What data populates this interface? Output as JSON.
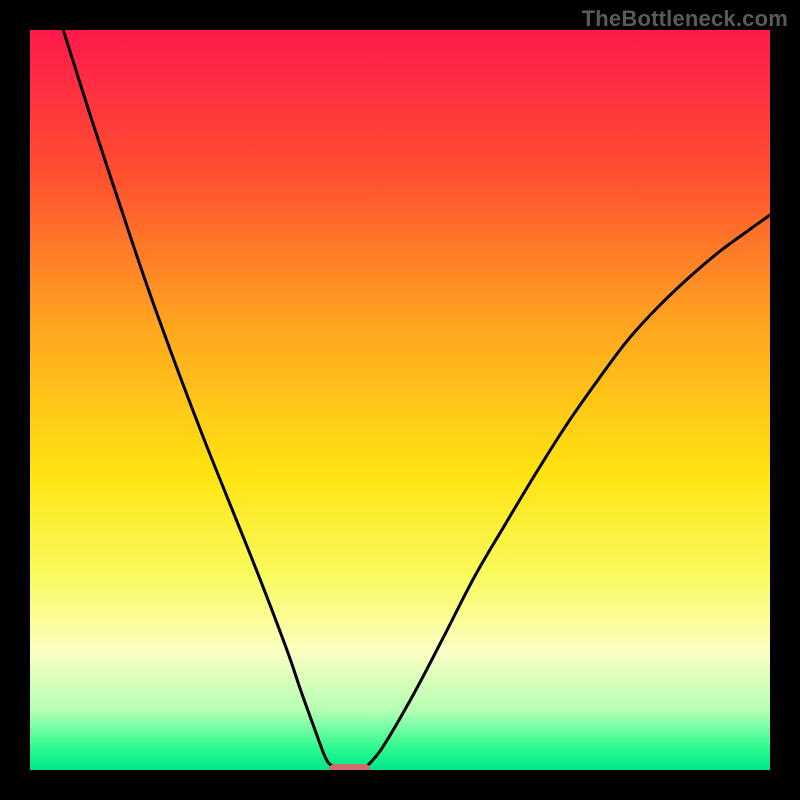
{
  "watermark": "TheBottleneck.com",
  "chart_data": {
    "type": "line",
    "title": "",
    "xlabel": "",
    "ylabel": "",
    "xlim": [
      0,
      1
    ],
    "ylim": [
      0,
      100
    ],
    "grid": false,
    "background": {
      "type": "vertical_gradient",
      "stops": [
        {
          "pos": 0.0,
          "color": "#ff1a4b"
        },
        {
          "pos": 0.2,
          "color": "#ff5130"
        },
        {
          "pos": 0.4,
          "color": "#ffa61f"
        },
        {
          "pos": 0.6,
          "color": "#ffe411"
        },
        {
          "pos": 0.74,
          "color": "#f8fb60"
        },
        {
          "pos": 0.84,
          "color": "#fcfec2"
        },
        {
          "pos": 0.92,
          "color": "#b4ffb4"
        },
        {
          "pos": 0.97,
          "color": "#2dfa8f"
        },
        {
          "pos": 1.0,
          "color": "#00e58a"
        }
      ]
    },
    "series": [
      {
        "name": "left_curve",
        "color": "#000000",
        "x": [
          0.045,
          0.083,
          0.121,
          0.158,
          0.196,
          0.234,
          0.272,
          0.31,
          0.348,
          0.365,
          0.383,
          0.4,
          0.41
        ],
        "y": [
          100.0,
          88.0,
          76.5,
          65.5,
          55.0,
          45.0,
          35.5,
          26.0,
          16.0,
          11.0,
          6.0,
          1.5,
          0.5
        ]
      },
      {
        "name": "right_curve",
        "color": "#000000",
        "x": [
          0.455,
          0.476,
          0.517,
          0.559,
          0.6,
          0.641,
          0.683,
          0.724,
          0.766,
          0.807,
          0.848,
          0.89,
          0.931,
          0.972,
          1.0
        ],
        "y": [
          0.5,
          3.0,
          10.0,
          18.0,
          26.0,
          33.0,
          40.0,
          46.5,
          52.5,
          58.0,
          62.5,
          66.5,
          70.0,
          73.0,
          75.0
        ]
      }
    ],
    "annotations": [
      {
        "name": "marker",
        "shape": "rounded_rect",
        "x": 0.432,
        "y": 0.2,
        "width_frac": 0.055,
        "height_frac": 0.012,
        "color": "#d46a6a"
      }
    ]
  }
}
